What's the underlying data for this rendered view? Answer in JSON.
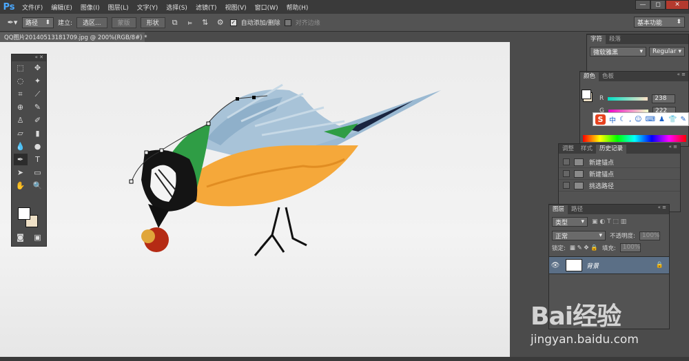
{
  "app": {
    "logo": "Ps"
  },
  "menu": [
    "文件(F)",
    "编辑(E)",
    "图像(I)",
    "图层(L)",
    "文字(Y)",
    "选择(S)",
    "滤镜(T)",
    "视图(V)",
    "窗口(W)",
    "帮助(H)"
  ],
  "window_controls": {
    "minimize": "—",
    "restore": "◻",
    "close": "✕"
  },
  "options": {
    "tool_mode": "路径",
    "make_label": "建立:",
    "selection_btn": "选区...",
    "mask_btn": "蒙版",
    "shape_btn": "形状",
    "auto_add_delete": "自动添加/删除",
    "align_edges": "对齐边缘",
    "workspace": "基本功能"
  },
  "document": {
    "tab_title": "QQ图片20140513181709.jpg @ 200%(RGB/8#) *"
  },
  "character_panel": {
    "tabs": [
      "字符",
      "段落"
    ],
    "font_family": "微软雅黑",
    "font_style": "Regular"
  },
  "color_panel": {
    "tabs": [
      "颜色",
      "色板"
    ],
    "channels": [
      {
        "label": "R",
        "value": "238"
      },
      {
        "label": "G",
        "value": "222"
      }
    ],
    "colors": {
      "fg": "#ffffff",
      "bg": "#eee0c6"
    }
  },
  "history_panel": {
    "tabs": [
      "调整",
      "样式",
      "历史记录"
    ],
    "items": [
      "新建锚点",
      "新建锚点",
      "新建锚点",
      "挑选路径",
      "新建锚点"
    ]
  },
  "layers_panel": {
    "tabs": [
      "图层",
      "路径"
    ],
    "filter_kind": "类型",
    "blend_mode": "正常",
    "opacity_label": "不透明度:",
    "opacity_value": "100%",
    "lock_label": "锁定:",
    "fill_label": "填充:",
    "fill_value": "100%",
    "layers": [
      {
        "name": "背景",
        "locked": true,
        "visible": true
      }
    ]
  },
  "ime": {
    "mode": "中"
  },
  "watermark": {
    "brand": "Bai经验",
    "url": "jingyan.baidu.com"
  }
}
